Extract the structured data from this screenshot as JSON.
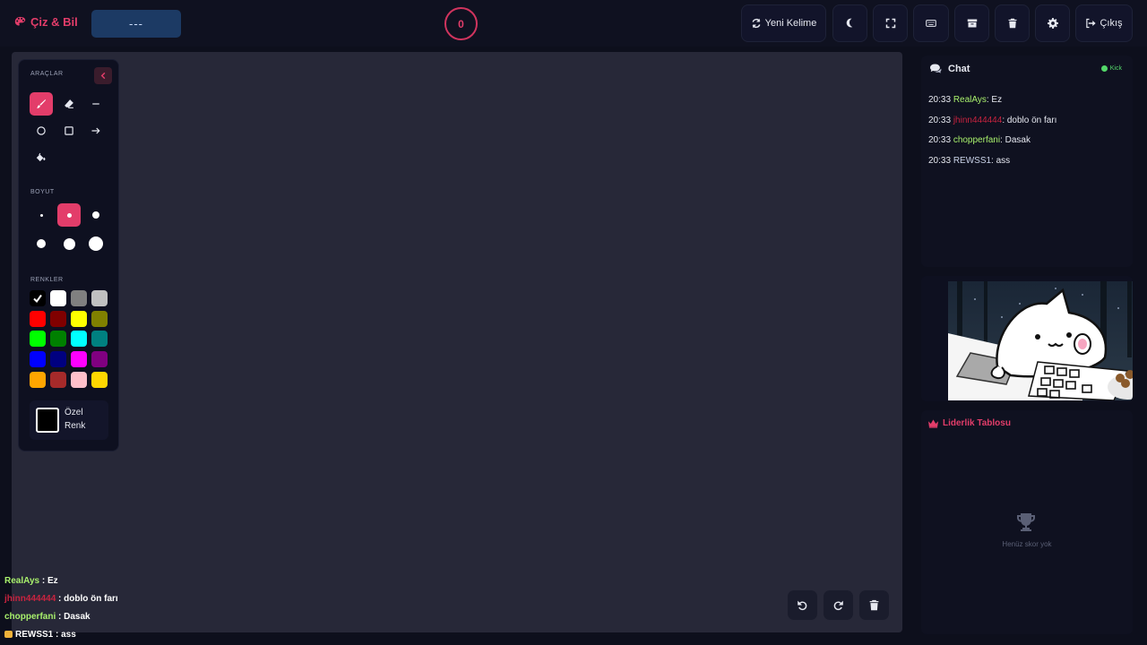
{
  "app": {
    "title": "Çiz & Bil"
  },
  "header": {
    "word_hint": "---",
    "timer": "0",
    "new_word_label": "Yeni Kelime",
    "logout_label": "Çıkış"
  },
  "tools_panel": {
    "tools_title": "ARAÇLAR",
    "size_title": "BOYUT",
    "colors_title": "RENKLER",
    "custom_color_line1": "Özel",
    "custom_color_line2": "Renk",
    "tools": [
      "brush-icon",
      "eraser-icon",
      "line-icon",
      "circle-icon",
      "rectangle-icon",
      "arrow-icon",
      "fill-bucket-icon"
    ],
    "active_tool": "brush",
    "active_size_index": 1,
    "colors": [
      "#000000",
      "#ffffff",
      "#808080",
      "#c0c0c0",
      "#ff0000",
      "#800000",
      "#ffff00",
      "#808000",
      "#00ff00",
      "#008000",
      "#00ffff",
      "#008080",
      "#0000ff",
      "#000080",
      "#ff00ff",
      "#800080",
      "#ffa500",
      "#a52a2a",
      "#ffc0cb",
      "#ffd700"
    ],
    "selected_color": "#000000"
  },
  "overlay_chat": [
    {
      "user": "RealAys",
      "text": " : Ez",
      "color": "#a8f06c"
    },
    {
      "user": "jhinn444444",
      "text": " : doblo ön farı",
      "color": "#c8233f"
    },
    {
      "user": "chopperfani",
      "text": " : Dasak",
      "color": "#a8f06c"
    },
    {
      "user": "REWSS1",
      "text": " : ass",
      "color": "#ffffff"
    }
  ],
  "chat": {
    "title": "Chat",
    "source_label": "Kick",
    "messages": [
      {
        "time": "20:33",
        "user": "RealAys",
        "text": ": Ez",
        "color": "#a8f06c"
      },
      {
        "time": "20:33",
        "user": "jhinn444444",
        "text": ": doblo ön farı",
        "color": "#c8233f"
      },
      {
        "time": "20:33",
        "user": "chopperfani",
        "text": ": Dasak",
        "color": "#a8f06c"
      },
      {
        "time": "20:33",
        "user": "REWSS1",
        "text": ": ass",
        "color": "#c9d2e8"
      }
    ]
  },
  "leaderboard": {
    "title": "Liderlik Tablosu",
    "empty_text": "Henüz skor yok"
  },
  "colors": {
    "accent": "#e33d6a",
    "canvas": "#272838",
    "panel": "#0f1120"
  }
}
